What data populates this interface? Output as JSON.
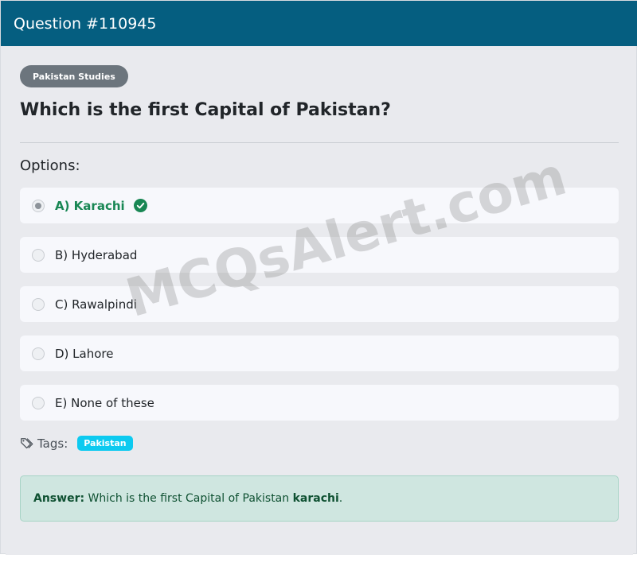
{
  "header": {
    "title": "Question #110945"
  },
  "question": {
    "category": "Pakistan Studies",
    "text": "Which is the first Capital of Pakistan?"
  },
  "options_heading": "Options:",
  "options": [
    {
      "label": "A) Karachi",
      "selected": true,
      "correct": true
    },
    {
      "label": "B) Hyderabad",
      "selected": false,
      "correct": false
    },
    {
      "label": "C) Rawalpindi",
      "selected": false,
      "correct": false
    },
    {
      "label": "D) Lahore",
      "selected": false,
      "correct": false
    },
    {
      "label": "E) None of these",
      "selected": false,
      "correct": false
    }
  ],
  "watermark": "MCQsAlert.com",
  "tags": {
    "label": "Tags:",
    "items": [
      "Pakistan"
    ]
  },
  "answer": {
    "prefix": "Answer:",
    "text": "Which is the first Capital of Pakistan",
    "value": "karachi",
    "suffix": "."
  },
  "colors": {
    "header_bg": "#055e80",
    "correct": "#198754",
    "tag_bg": "#0dcaf0",
    "answer_bg": "#cfe6e0"
  },
  "icons": {
    "correct": "check-circle-icon",
    "tag": "tags-icon"
  }
}
